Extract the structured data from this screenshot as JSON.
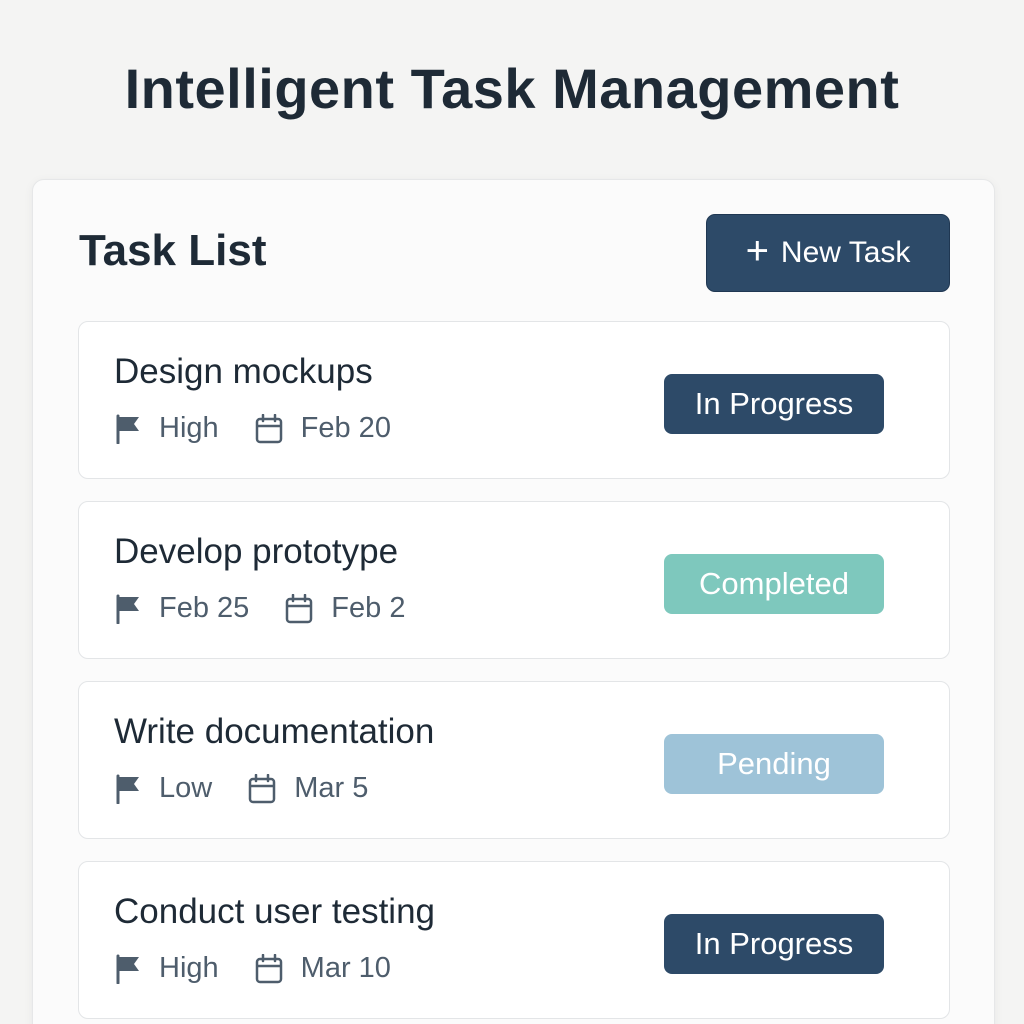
{
  "app": {
    "title": "Intelligent Task Management"
  },
  "panel": {
    "title": "Task List",
    "new_task_label": "New Task",
    "new_task_icon": "plus-icon"
  },
  "status_colors": {
    "In Progress": "#2d4a68",
    "Completed": "#7ec8bd",
    "Pending": "#9ec3d8"
  },
  "tasks": [
    {
      "title": "Design mockups",
      "priority": "High",
      "date": "Feb 20",
      "status": "In Progress"
    },
    {
      "title": "Develop prototype",
      "priority": "Feb 25",
      "date": "Feb 2",
      "status": "Completed"
    },
    {
      "title": "Write documentation",
      "priority": "Low",
      "date": "Mar 5",
      "status": "Pending"
    },
    {
      "title": "Conduct user testing",
      "priority": "High",
      "date": "Mar 10",
      "status": "In Progress"
    }
  ]
}
